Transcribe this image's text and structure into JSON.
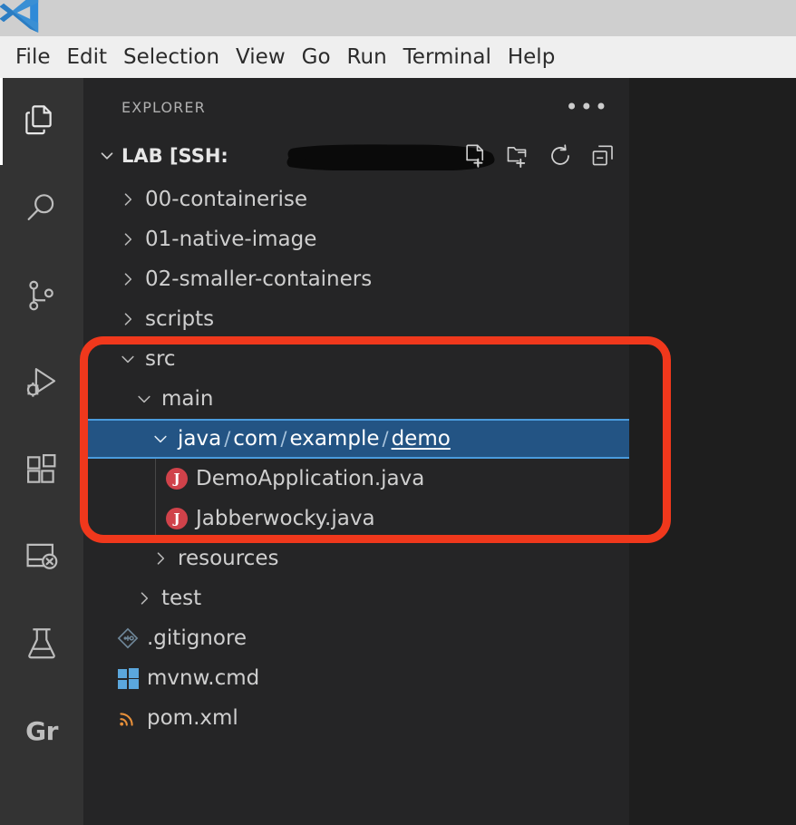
{
  "window": {
    "app_logo": "vscode-logo"
  },
  "menubar": {
    "items": [
      {
        "label": "File"
      },
      {
        "label": "Edit"
      },
      {
        "label": "Selection"
      },
      {
        "label": "View"
      },
      {
        "label": "Go"
      },
      {
        "label": "Run"
      },
      {
        "label": "Terminal"
      },
      {
        "label": "Help"
      }
    ]
  },
  "activity_bar": {
    "items": [
      {
        "name": "explorer",
        "icon": "files-icon",
        "active": true
      },
      {
        "name": "search",
        "icon": "search-icon",
        "active": false
      },
      {
        "name": "source-control",
        "icon": "source-control-branch-icon",
        "active": false
      },
      {
        "name": "run-debug",
        "icon": "run-and-debug-icon",
        "active": false
      },
      {
        "name": "extensions",
        "icon": "extensions-icon",
        "active": false
      },
      {
        "name": "remote-explorer",
        "icon": "remote-explorer-icon",
        "active": false
      },
      {
        "name": "testing",
        "icon": "beaker-flask-icon",
        "active": false
      },
      {
        "name": "gradle",
        "icon": "gradle-text-icon",
        "label": "Gr",
        "active": false
      }
    ]
  },
  "sidebar": {
    "title": "EXPLORER",
    "views_menu": "•••",
    "root": {
      "label": "LAB [SSH:",
      "redacted": true,
      "expanded": true,
      "actions": [
        {
          "name": "new-file",
          "icon": "new-file-icon"
        },
        {
          "name": "new-folder",
          "icon": "new-folder-icon"
        },
        {
          "name": "refresh",
          "icon": "refresh-icon"
        },
        {
          "name": "collapse-folders",
          "icon": "collapse-all-icon"
        }
      ]
    },
    "tree": [
      {
        "label": "00-containerise",
        "type": "folder",
        "depth": 0,
        "expanded": false,
        "selected": false
      },
      {
        "label": "01-native-image",
        "type": "folder",
        "depth": 0,
        "expanded": false,
        "selected": false
      },
      {
        "label": "02-smaller-containers",
        "type": "folder",
        "depth": 0,
        "expanded": false,
        "selected": false
      },
      {
        "label": "scripts",
        "type": "folder",
        "depth": 0,
        "expanded": false,
        "selected": false
      },
      {
        "label": "src",
        "type": "folder",
        "depth": 0,
        "expanded": true,
        "selected": false
      },
      {
        "label": "main",
        "type": "folder",
        "depth": 1,
        "expanded": true,
        "selected": false
      },
      {
        "label": "java/com/example/demo",
        "type": "folder",
        "depth": 2,
        "expanded": true,
        "selected": true,
        "segments": [
          "java",
          "com",
          "example",
          "demo"
        ]
      },
      {
        "label": "DemoApplication.java",
        "type": "java-file",
        "depth": 3,
        "selected": false
      },
      {
        "label": "Jabberwocky.java",
        "type": "java-file",
        "depth": 3,
        "selected": false
      },
      {
        "label": "resources",
        "type": "folder",
        "depth": 2,
        "expanded": false,
        "selected": false
      },
      {
        "label": "test",
        "type": "folder",
        "depth": 1,
        "expanded": false,
        "selected": false
      },
      {
        "label": ".gitignore",
        "type": "git-file",
        "depth": 0,
        "selected": false
      },
      {
        "label": "mvnw.cmd",
        "type": "windows-file",
        "depth": 0,
        "selected": false
      },
      {
        "label": "pom.xml",
        "type": "maven-file",
        "depth": 0,
        "selected": false
      }
    ]
  },
  "annotation": {
    "shape": "rounded-rectangle-highlight",
    "color": "#f0381c",
    "covers": [
      "src",
      "main",
      "java/com/example/demo",
      "DemoApplication.java",
      "Jabberwocky.java"
    ]
  },
  "colors": {
    "titlebar": "#cfcfcf",
    "menubar": "#efefef",
    "activity_bar": "#333333",
    "sidebar": "#252526",
    "editor": "#1e1e1e",
    "selection": "#235484",
    "selection_border": "#4a9bdd",
    "java_icon": "#d0424a",
    "windows_icon": "#5ba7dd",
    "maven_icon": "#e8903a",
    "annotation": "#f0381c",
    "text": "#cfcfcf"
  }
}
